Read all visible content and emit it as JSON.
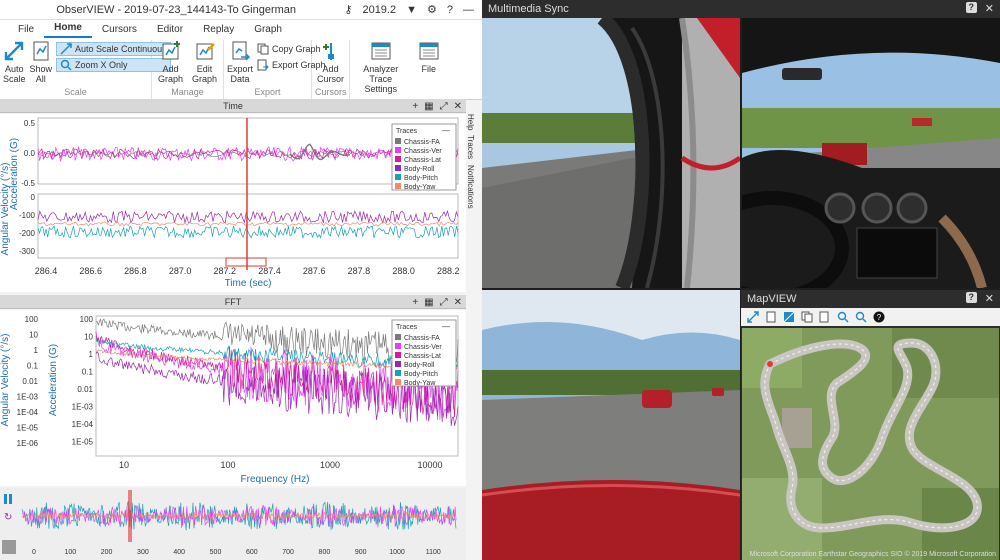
{
  "window": {
    "title": "ObserVIEW - 2019-07-23_144143-To Gingerman",
    "version": "2019.2"
  },
  "menu": [
    "File",
    "Home",
    "Cursors",
    "Editor",
    "Replay",
    "Graph"
  ],
  "ribbon": {
    "auto_scale": "Auto Scale",
    "show_all": "Show All",
    "auto_scale_continuous": "Auto Scale Continuous",
    "zoom_x_only": "Zoom X Only",
    "group_scale": "Scale",
    "add_graph": "Add Graph",
    "edit_graph": "Edit Graph",
    "group_manage": "Manage",
    "export_data": "Export Data",
    "copy_graph": "Copy Graph",
    "export_graph": "Export Graph",
    "group_export": "Export",
    "add_cursor": "Add Cursor",
    "group_cursors": "Cursors",
    "analyzer_settings": "Analyzer Trace Settings",
    "file": "File"
  },
  "side_tabs": [
    "Help",
    "Traces",
    "Notifications"
  ],
  "time_panel": {
    "title": "Time",
    "y_label": "Angular Velocity (°/s)",
    "y_label2": "Acceleration (G)",
    "x_label": "Time (sec)",
    "x_ticks": [
      "286.4",
      "286.6",
      "286.8",
      "287.0",
      "287.2",
      "287.4",
      "287.6",
      "287.8",
      "288.0",
      "288.2"
    ],
    "y_ticks_top": [
      "0.5",
      "0.0",
      "-0.5"
    ],
    "y_ticks_bottom": [
      "0",
      "-100",
      "-200",
      "-300"
    ],
    "traces_title": "Traces",
    "traces": [
      "Chassis-FA",
      "Chassis-Ver",
      "Chassis-Lat",
      "Body-Roll",
      "Body-Pitch",
      "Body-Yaw"
    ]
  },
  "fft_panel": {
    "title": "FFT",
    "y_label": "Angular Velocity (°/s)",
    "y_label2": "Acceleration (G)",
    "x_label": "Frequency (Hz)",
    "x_ticks": [
      "10",
      "100",
      "1000",
      "10000"
    ],
    "y_ticks_outer": [
      "100",
      "10",
      "1",
      "0.1",
      "0.01",
      "1E-03",
      "1E-04",
      "1E-05",
      "1E-06"
    ],
    "y_ticks_inner": [
      "100",
      "10",
      "1",
      "0.1",
      "0.01",
      "1E-03",
      "1E-04",
      "1E-05"
    ],
    "traces_title": "Traces",
    "traces": [
      "Chassis-FA",
      "Chassis-Ver",
      "Chassis-Lat",
      "Body-Roll",
      "Body-Pitch",
      "Body-Yaw"
    ]
  },
  "overview": {
    "x_ticks": [
      "0",
      "100",
      "200",
      "300",
      "400",
      "500",
      "600",
      "700",
      "800",
      "900",
      "1000",
      "1100"
    ]
  },
  "multimedia": {
    "title": "Multimedia Sync"
  },
  "mapview": {
    "title": "MapVIEW",
    "credit": "Microsoft Corporation Earthstar Geographics SIO © 2019 Microsoft Corporation"
  },
  "colors": {
    "chassis_fa": "#7a7a7a",
    "chassis_ver": "#e040fb",
    "chassis_lat": "#d81b9b",
    "body_roll": "#9c27b0",
    "body_pitch": "#17a2b8",
    "body_yaw": "#f08a6a",
    "cursor": "#e53935"
  }
}
